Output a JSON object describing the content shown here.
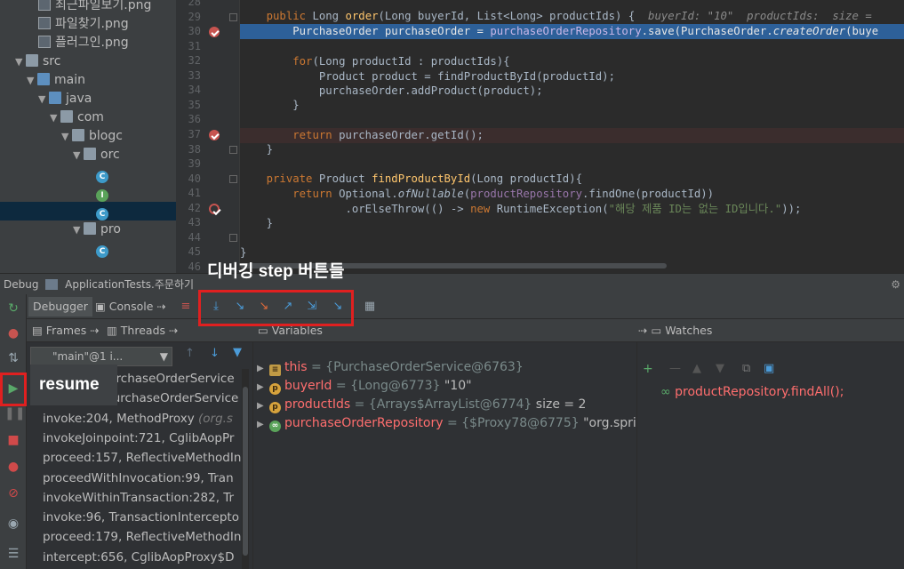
{
  "project_tree": [
    {
      "label": "최근파일보기.png",
      "kind": "image",
      "indent": 3
    },
    {
      "label": "파일찾기.png",
      "kind": "image",
      "indent": 3
    },
    {
      "label": "플러그인.png",
      "kind": "image",
      "indent": 3
    },
    {
      "label": "src",
      "kind": "folder",
      "indent": 1,
      "arrow": "▼"
    },
    {
      "label": "main",
      "kind": "folder-blue",
      "indent": 2,
      "arrow": "▼"
    },
    {
      "label": "java",
      "kind": "folder-blue",
      "indent": 3,
      "arrow": "▼"
    },
    {
      "label": "com",
      "kind": "folder",
      "indent": 4,
      "arrow": "▼"
    },
    {
      "label": "blogc",
      "kind": "folder",
      "indent": 5,
      "arrow": "▼"
    },
    {
      "label": "orc",
      "kind": "folder",
      "indent": 6,
      "arrow": "▼"
    },
    {
      "label": "",
      "kind": "class",
      "indent": 8
    },
    {
      "label": "",
      "kind": "interface",
      "indent": 8
    },
    {
      "label": "",
      "kind": "class",
      "indent": 8,
      "selected": true
    },
    {
      "label": "pro",
      "kind": "folder",
      "indent": 6,
      "arrow": "▼"
    },
    {
      "label": "",
      "kind": "class",
      "indent": 8
    }
  ],
  "editor": {
    "lines": [
      "28",
      "29",
      "30",
      "31",
      "32",
      "33",
      "34",
      "35",
      "36",
      "37",
      "38",
      "39",
      "40",
      "41",
      "42",
      "43",
      "44",
      "45",
      "46"
    ],
    "breakpoints": [
      {
        "line": "30",
        "kind": "normal"
      },
      {
        "line": "37",
        "kind": "normal"
      },
      {
        "line": "42",
        "kind": "exception"
      }
    ],
    "code": {
      "l29_a": "    ",
      "l29_kw": "public ",
      "l29_type": "Long ",
      "l29_fn": "order",
      "l29_rest": "(Long buyerId, List<Long> productIds) {",
      "l29_hint": "  buyerId: \"10\"  productIds:  size =",
      "l30": "        PurchaseOrder purchaseOrder = ",
      "l30_fld": "purchaseOrderRepository",
      "l30_rest": ".save(PurchaseOrder.",
      "l30_it": "createOrder",
      "l30_tail": "(buye",
      "l32_kw": "for",
      "l32_rest": "(Long productId : productIds){",
      "l33": "            Product product = findProductById(productId);",
      "l34": "            purchaseOrder.addProduct(product);",
      "l35": "        }",
      "l37_kw": "return ",
      "l37_rest": "purchaseOrder.getId();",
      "l38": "    }",
      "l40_kw": "private ",
      "l40_type": "Product ",
      "l40_fn": "findProductById",
      "l40_rest": "(Long productId){",
      "l41_kw": "return ",
      "l41_a": "Optional.",
      "l41_it": "ofNullable",
      "l41_b": "(",
      "l41_fld": "productRepository",
      "l41_c": ".findOne(productId))",
      "l42_a": "                .orElseThrow(() -> ",
      "l42_kw": "new ",
      "l42_b": "RuntimeException(",
      "l42_str": "\"해당 제품 ID는 없는 ID입니다.\"",
      "l42_c": "));",
      "l43": "    }",
      "l45": "}"
    }
  },
  "debug": {
    "title_prefix": "Debug",
    "config_name": "ApplicationTests.주문하기",
    "tabs": {
      "debugger": "Debugger",
      "console": "Console"
    },
    "subtabs": {
      "frames": "Frames",
      "threads": "Threads",
      "variables": "Variables",
      "watches": "Watches"
    },
    "thread_select": "\"main\"@1 i...",
    "frames": [
      {
        "method": "order:30, PurchaseOrderService",
        "lib": ""
      },
      {
        "method": "invoke:-1, PurchaseOrderService",
        "lib": ""
      },
      {
        "method": "invoke:204, MethodProxy ",
        "lib": "(org.s"
      },
      {
        "method": "invokeJoinpoint:721, CglibAopPr",
        "lib": ""
      },
      {
        "method": "proceed:157, ReflectiveMethodIn",
        "lib": ""
      },
      {
        "method": "proceedWithInvocation:99, Tran",
        "lib": ""
      },
      {
        "method": "invokeWithinTransaction:282, Tr",
        "lib": ""
      },
      {
        "method": "invoke:96, TransactionIntercepto",
        "lib": ""
      },
      {
        "method": "proceed:179, ReflectiveMethodIn",
        "lib": ""
      },
      {
        "method": "intercept:656, CglibAopProxy$D",
        "lib": ""
      }
    ],
    "variables": [
      {
        "name": "this",
        "value": " = {PurchaseOrderService@6763}",
        "extra": "",
        "icon": "sq"
      },
      {
        "name": "buyerId",
        "value": " = {Long@6773} ",
        "extra": "\"10\"",
        "icon": "p"
      },
      {
        "name": "productIds",
        "value": " = {Arrays$ArrayList@6774} ",
        "extra": " size = 2",
        "icon": "p"
      },
      {
        "name": "purchaseOrderRepository",
        "value": " = {$Proxy78@6775} ",
        "extra": "\"org.sprin",
        "icon": "glass"
      }
    ],
    "watches": [
      "productRepository.findAll();"
    ]
  },
  "annotations": {
    "step_buttons": "디버깅 step 버튼들",
    "resume": "resume"
  },
  "colors": {
    "accent_red": "#e02020",
    "exec_line": "#2d6099",
    "breakpoint": "#c75450"
  }
}
